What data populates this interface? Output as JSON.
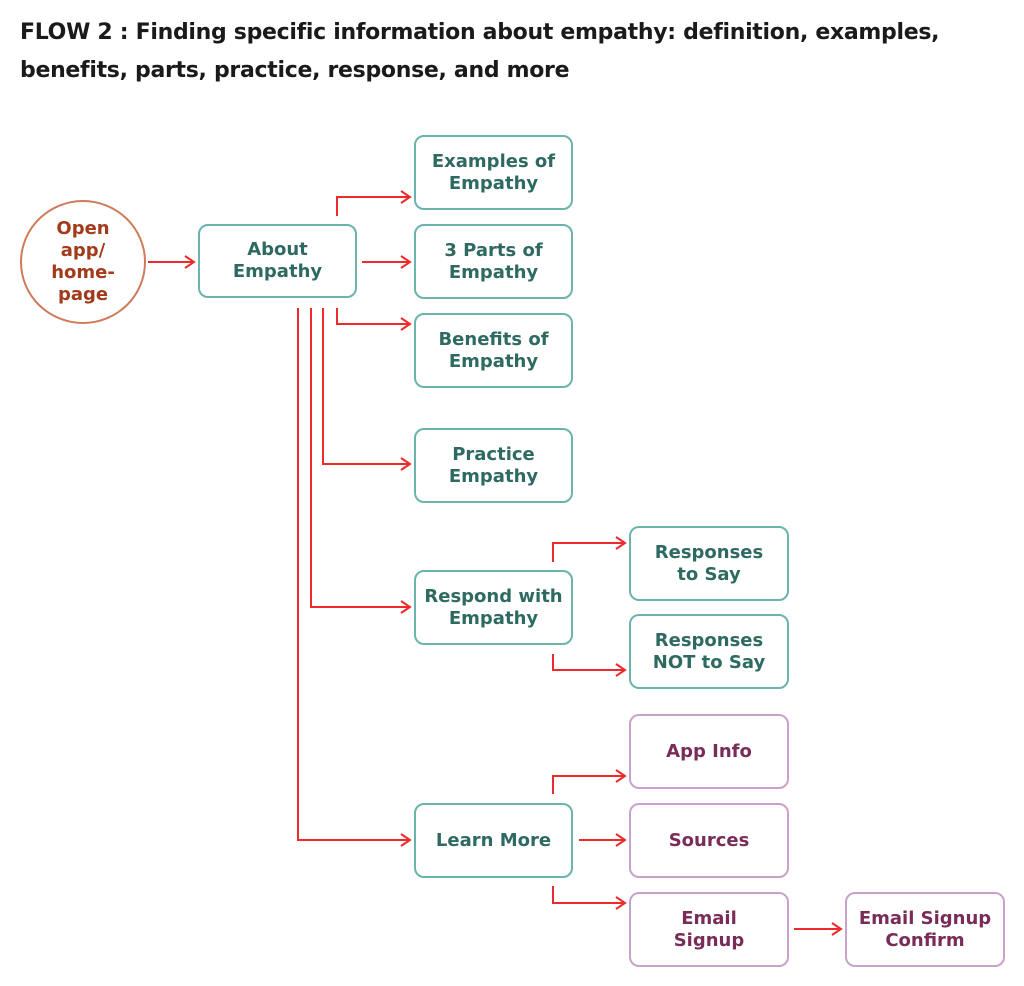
{
  "title": "FLOW 2 : Finding specific information about empathy: definition, examples, benefits, parts, practice, response, and more",
  "colors": {
    "connector": "#ee2a2a",
    "teal_border": "#6bb3ad",
    "teal_text": "#2e6a62",
    "purple_border": "#c9a2cc",
    "purple_text": "#7a2c58",
    "start_border": "#cf7b5a",
    "start_text": "#a23a1c"
  },
  "nodes": {
    "open_app": "Open\napp/\nhome-\npage",
    "about_empathy": "About\nEmpathy",
    "examples_of_empathy": "Examples of\nEmpathy",
    "three_parts_of_empathy": "3 Parts of\nEmpathy",
    "benefits_of_empathy": "Benefits of\nEmpathy",
    "practice_empathy": "Practice\nEmpathy",
    "respond_with_empathy": "Respond with\nEmpathy",
    "responses_to_say": "Responses\nto Say",
    "responses_not_to_say": "Responses\nNOT to Say",
    "learn_more": "Learn More",
    "app_info": "App Info",
    "sources": "Sources",
    "email_signup": "Email\nSignup",
    "email_signup_confirm": "Email Signup\nConfirm"
  },
  "edges": [
    {
      "from": "open_app",
      "to": "about_empathy"
    },
    {
      "from": "about_empathy",
      "to": "examples_of_empathy"
    },
    {
      "from": "about_empathy",
      "to": "three_parts_of_empathy"
    },
    {
      "from": "about_empathy",
      "to": "benefits_of_empathy"
    },
    {
      "from": "about_empathy",
      "to": "practice_empathy"
    },
    {
      "from": "about_empathy",
      "to": "respond_with_empathy"
    },
    {
      "from": "about_empathy",
      "to": "learn_more"
    },
    {
      "from": "respond_with_empathy",
      "to": "responses_to_say"
    },
    {
      "from": "respond_with_empathy",
      "to": "responses_not_to_say"
    },
    {
      "from": "learn_more",
      "to": "app_info"
    },
    {
      "from": "learn_more",
      "to": "sources"
    },
    {
      "from": "learn_more",
      "to": "email_signup"
    },
    {
      "from": "email_signup",
      "to": "email_signup_confirm"
    }
  ]
}
